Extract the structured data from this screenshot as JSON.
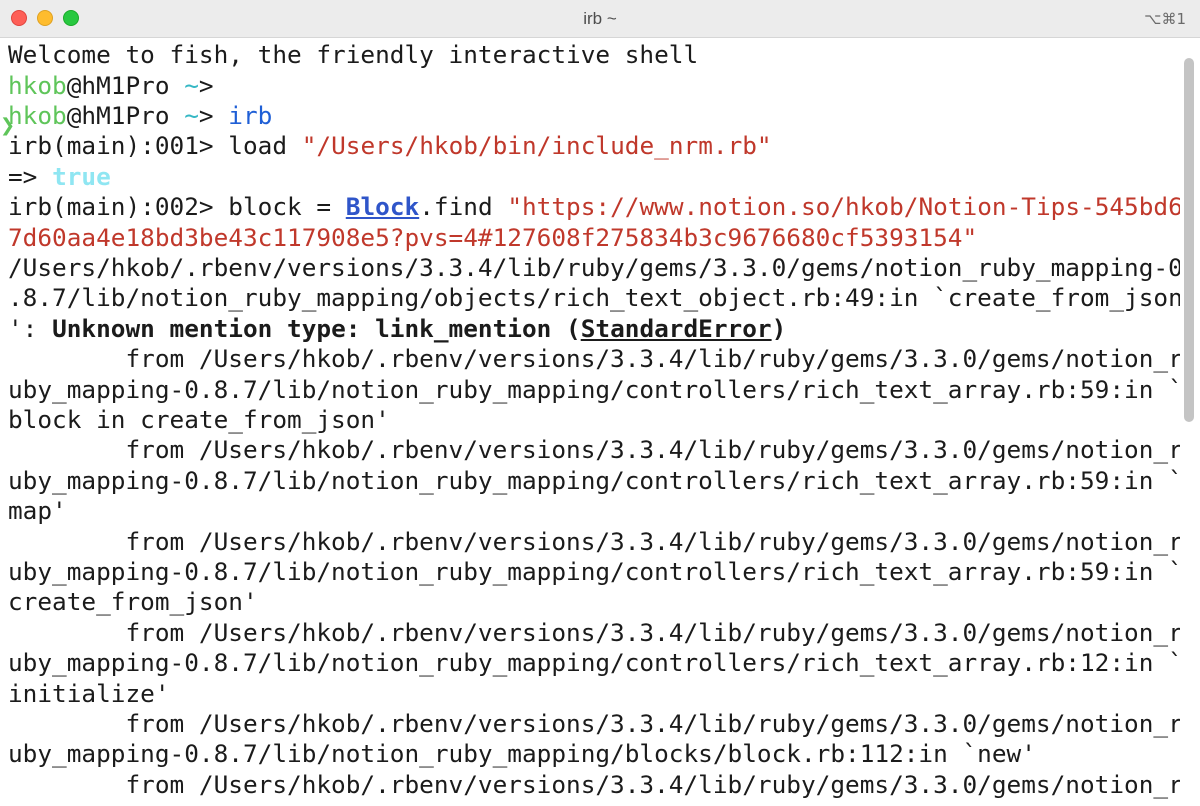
{
  "window": {
    "title": "irb ~",
    "shortcut": "⌥⌘1"
  },
  "terminal": {
    "welcome": "Welcome to fish, the friendly interactive shell",
    "prompt_user": "hkob",
    "prompt_host": "@hM1Pro ",
    "prompt_cwd": "~",
    "prompt_arrow": "> ",
    "prompt_mark": "❯",
    "cmd_irb": "irb",
    "irb_prompt_1": "irb(main):001> ",
    "load_kw": "load ",
    "load_path": "\"/Users/hkob/bin/include_nrm.rb\"",
    "result_arrow": "=> ",
    "result_true": "true",
    "irb_prompt_2": "irb(main):002> ",
    "block_assign": "block = ",
    "block_class": "Block",
    "block_find": ".find ",
    "url_part1": "\"https://www.notion.so/hkob/Notion-Tips-545bd6",
    "url_part2": "7d60aa4e18bd3be43c117908e5?pvs=4#127608f275834b3c9676680cf5393154\"",
    "err_line1": "/Users/hkob/.rbenv/versions/3.3.4/lib/ruby/gems/3.3.0/gems/notion_ruby_mapping-0",
    "err_line2": ".8.7/lib/notion_ruby_mapping/objects/rich_text_object.rb:49:in `create_from_json",
    "err_line3_prefix": "': ",
    "err_line3_msg": "Unknown mention type: link_mention (",
    "err_line3_class": "StandardError",
    "err_line3_close": ")",
    "trace": [
      "        from /Users/hkob/.rbenv/versions/3.3.4/lib/ruby/gems/3.3.0/gems/notion_r",
      "uby_mapping-0.8.7/lib/notion_ruby_mapping/controllers/rich_text_array.rb:59:in `",
      "block in create_from_json'",
      "        from /Users/hkob/.rbenv/versions/3.3.4/lib/ruby/gems/3.3.0/gems/notion_r",
      "uby_mapping-0.8.7/lib/notion_ruby_mapping/controllers/rich_text_array.rb:59:in `",
      "map'",
      "        from /Users/hkob/.rbenv/versions/3.3.4/lib/ruby/gems/3.3.0/gems/notion_r",
      "uby_mapping-0.8.7/lib/notion_ruby_mapping/controllers/rich_text_array.rb:59:in `",
      "create_from_json'",
      "        from /Users/hkob/.rbenv/versions/3.3.4/lib/ruby/gems/3.3.0/gems/notion_r",
      "uby_mapping-0.8.7/lib/notion_ruby_mapping/controllers/rich_text_array.rb:12:in `",
      "initialize'",
      "        from /Users/hkob/.rbenv/versions/3.3.4/lib/ruby/gems/3.3.0/gems/notion_r",
      "uby_mapping-0.8.7/lib/notion_ruby_mapping/blocks/block.rb:112:in `new'",
      "        from /Users/hkob/.rbenv/versions/3.3.4/lib/ruby/gems/3.3.0/gems/notion_r"
    ]
  }
}
